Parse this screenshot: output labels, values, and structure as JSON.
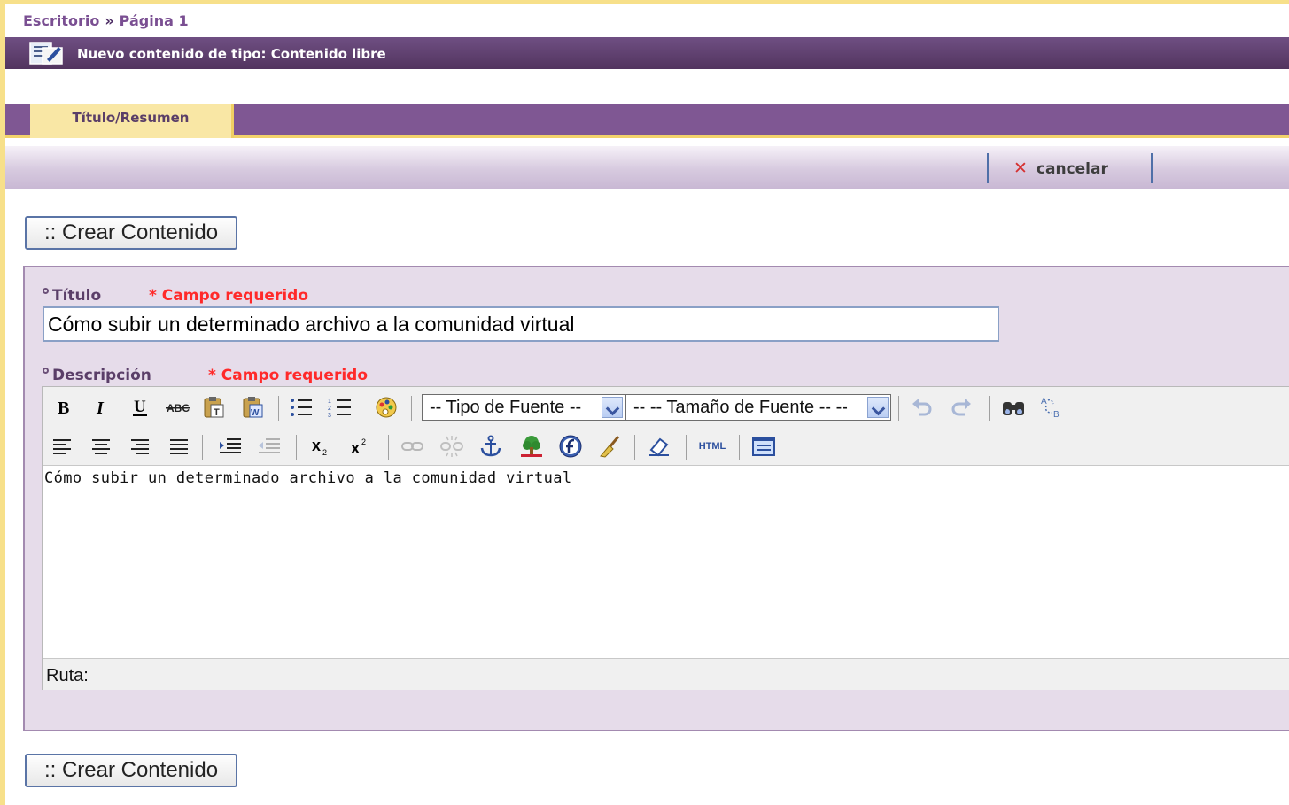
{
  "breadcrumb": {
    "root": "Escritorio",
    "separator": "»",
    "current": "Página 1"
  },
  "window_title": "Nuevo contenido de tipo: Contenido libre",
  "tabs": [
    {
      "label": "Título/Resumen"
    }
  ],
  "actions": {
    "cancel_label": "cancelar"
  },
  "create_button_label": ":: Crear Contenido",
  "form": {
    "title_label": "Título",
    "required_text": "* Campo requerido",
    "title_value": "Cómo subir un determinado archivo a la comunidad virtual",
    "description_label": "Descripción",
    "editor": {
      "font_family_select": "-- Tipo de Fuente --",
      "font_size_select": "-- -- Tamaño de Fuente -- --",
      "html_button": "HTML",
      "content": "Cómo subir un determinado archivo a la comunidad virtual",
      "path_label": "Ruta:"
    }
  },
  "colors": {
    "accent_purple": "#7f5793",
    "tab_yellow": "#f9e7a5",
    "required_red": "#ff2a2a"
  }
}
